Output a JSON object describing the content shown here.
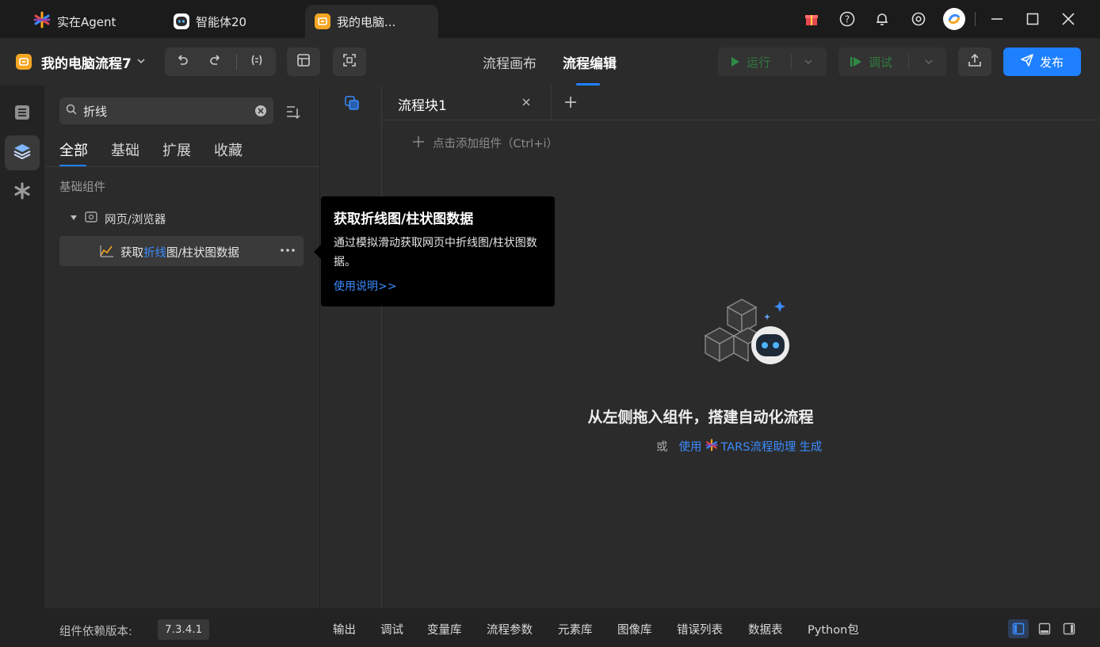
{
  "window_tabs": [
    {
      "label": "实在Agent"
    },
    {
      "label": "智能体20"
    },
    {
      "label": "我的电脑..."
    }
  ],
  "toolbar": {
    "flow_name": "我的电脑流程7",
    "mode_tabs": [
      "流程画布",
      "流程编辑"
    ],
    "active_mode": "流程编辑",
    "run_label": "运行",
    "debug_label": "调试",
    "publish_label": "发布"
  },
  "panel": {
    "search_value": "折线",
    "tabs": [
      "全部",
      "基础",
      "扩展",
      "收藏"
    ],
    "section_title": "基础组件",
    "group_label": "网页/浏览器",
    "result_item": {
      "prefix": "获取",
      "highlight": "折线",
      "suffix": "图/柱状图数据"
    },
    "dependency_label": "组件依赖版本:",
    "dependency_version": "7.3.4.1"
  },
  "tooltip": {
    "title": "获取折线图/柱状图数据",
    "description": "通过模拟滑动获取网页中折线图/柱状图数据。",
    "link": "使用说明>>"
  },
  "canvas": {
    "tab_label": "流程块1",
    "add_component_hint": "点击添加组件（Ctrl+i）",
    "empty_title": "从左侧拖入组件，搭建自动化流程",
    "empty_or": "或",
    "empty_use": "使用",
    "empty_assistant": "TARS流程助理",
    "empty_generate": "生成"
  },
  "bottom_tabs": [
    "输出",
    "调试",
    "变量库",
    "流程参数",
    "元素库",
    "图像库",
    "错误列表",
    "数据表",
    "Python包"
  ],
  "colors": {
    "accent": "#1e80ff",
    "run_green": "#2ea043",
    "tab_icon_orange": "#f5a623"
  }
}
